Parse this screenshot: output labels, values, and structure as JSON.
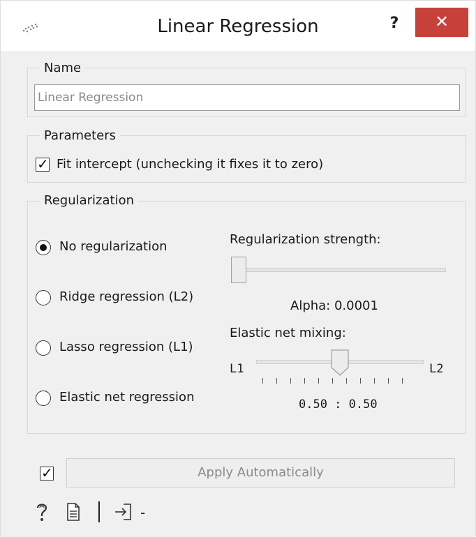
{
  "window": {
    "title": "Linear Regression",
    "help_glyph": "?",
    "close_glyph": "✕"
  },
  "name_group": {
    "title": "Name",
    "input_value": "Linear Regression"
  },
  "parameters_group": {
    "title": "Parameters",
    "fit_intercept_label": "Fit intercept (unchecking it fixes it to zero)",
    "fit_intercept_checked": true
  },
  "regularization_group": {
    "title": "Regularization",
    "options": [
      {
        "label": "No regularization",
        "selected": true
      },
      {
        "label": "Ridge regression (L2)",
        "selected": false
      },
      {
        "label": "Lasso regression (L1)",
        "selected": false
      },
      {
        "label": "Elastic net regression",
        "selected": false
      }
    ],
    "strength_label": "Regularization strength:",
    "strength_position": 0.0,
    "alpha_text": "Alpha: 0.0001",
    "mixing_label": "Elastic net mixing:",
    "mixing_left": "L1",
    "mixing_right": "L2",
    "mixing_position": 0.5,
    "mixing_text": "0.50 : 0.50"
  },
  "footer": {
    "auto_apply_checked": true,
    "apply_label": "Apply Automatically",
    "status_dash": "-"
  },
  "icons": {
    "app": "scatter-dots-icon",
    "help": "question-icon",
    "report": "document-icon",
    "input": "input-arrow-icon"
  }
}
